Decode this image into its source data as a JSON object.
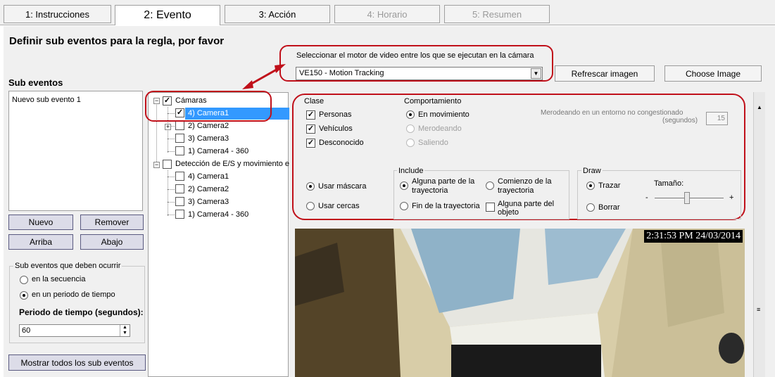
{
  "tabs": [
    {
      "label": "1: Instrucciones"
    },
    {
      "label": "2: Evento"
    },
    {
      "label": "3: Acción"
    },
    {
      "label": "4: Horario"
    },
    {
      "label": "5: Resumen"
    }
  ],
  "page_title": "Definir sub eventos para la regla, por favor",
  "engine": {
    "label": "Seleccionar el motor de video entre los que se ejecutan en la cámara",
    "selected": "VE150 - Motion Tracking",
    "refresh_label": "Refrescar imagen",
    "choose_label": "Choose Image"
  },
  "sub_events": {
    "title": "Sub eventos",
    "items": [
      "Nuevo sub evento 1"
    ],
    "new_label": "Nuevo",
    "remove_label": "Remover",
    "up_label": "Arriba",
    "down_label": "Abajo",
    "must_occur_title": "Sub eventos que deben ocurrir",
    "in_sequence": "en la secuencia",
    "in_period": "en un periodo de tiempo",
    "period_label": "Periodo de tiempo (segundos):",
    "period_value": "60",
    "show_all_label": "Mostrar todos los sub eventos"
  },
  "tree": {
    "cameras_label": "Cámaras",
    "cameras": [
      "4) Camera1",
      "2) Camera2",
      "3) Camera3",
      "1) Camera4 - 360"
    ],
    "detection_label": "Detección de E/S y movimiento e",
    "detection_items": [
      "4) Camera1",
      "2) Camera2",
      "3) Camera3",
      "1) Camera4 - 360"
    ]
  },
  "config": {
    "class_title": "Clase",
    "class_items": [
      "Personas",
      "Vehículos",
      "Desconocido"
    ],
    "behavior_title": "Comportamiento",
    "behavior_items": [
      "En movimiento",
      "Merodeando",
      "Saliendo"
    ],
    "loiter_label_1": "Merodeando en un entorno no congestionado",
    "loiter_label_2": "(segundos)",
    "loiter_value": "15",
    "use_mask": "Usar máscara",
    "use_fences": "Usar cercas",
    "include_title": "Include",
    "include_any_1": "Alguna parte de la",
    "include_any_2": "trayectoria",
    "include_start_1": "Comienzo de la",
    "include_start_2": "trayectoria",
    "include_end": "Fin de la trayectoria",
    "include_obj_1": "Alguna parte del",
    "include_obj_2": "objeto",
    "draw_title": "Draw",
    "draw_trace": "Trazar",
    "draw_erase": "Borrar",
    "size_label": "Tamaño:",
    "minus": "-",
    "plus": "+"
  },
  "video": {
    "timestamp": "2:31:53 PM 24/03/2014"
  }
}
